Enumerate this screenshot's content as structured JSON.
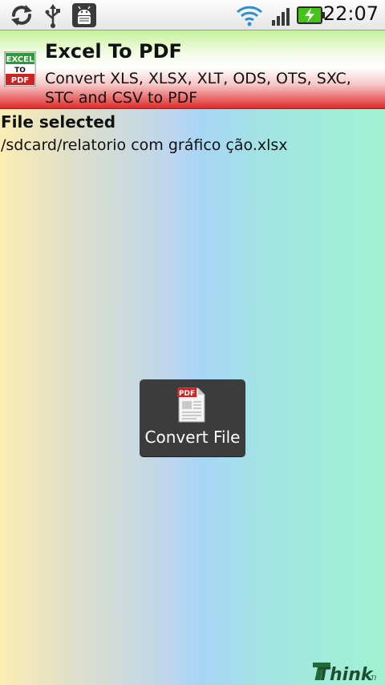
{
  "status_bar": {
    "time": "22:07",
    "icons": [
      "sync-icon",
      "usb-icon",
      "debug-icon",
      "wifi-icon",
      "signal-icon",
      "battery-charging-icon"
    ]
  },
  "header": {
    "title": "Excel To PDF",
    "subtitle": "Convert XLS, XLSX, XLT, ODS, OTS, SXC, STC and CSV to PDF",
    "logo_text_top": "EXCEL",
    "logo_text_mid": "TO",
    "logo_text_bottom": "PDF"
  },
  "content": {
    "file_label": "File selected",
    "file_path": "/sdcard/relatorio com gráfico ção.xlsx"
  },
  "convert_button": {
    "label": "Convert File",
    "icon_badge": "PDF"
  },
  "brand": {
    "name": "Think",
    "suffix": "TI"
  },
  "colors": {
    "header_top_green": "#c6f29a",
    "header_bottom_red": "#e02a2a",
    "background_left": "#fbedb4",
    "background_middle": "#a8d6f6",
    "background_right": "#a0f2d2",
    "button_bg": "#3c3c3c",
    "battery_green": "#46c21a",
    "brand_green": "#1f6b3a"
  }
}
